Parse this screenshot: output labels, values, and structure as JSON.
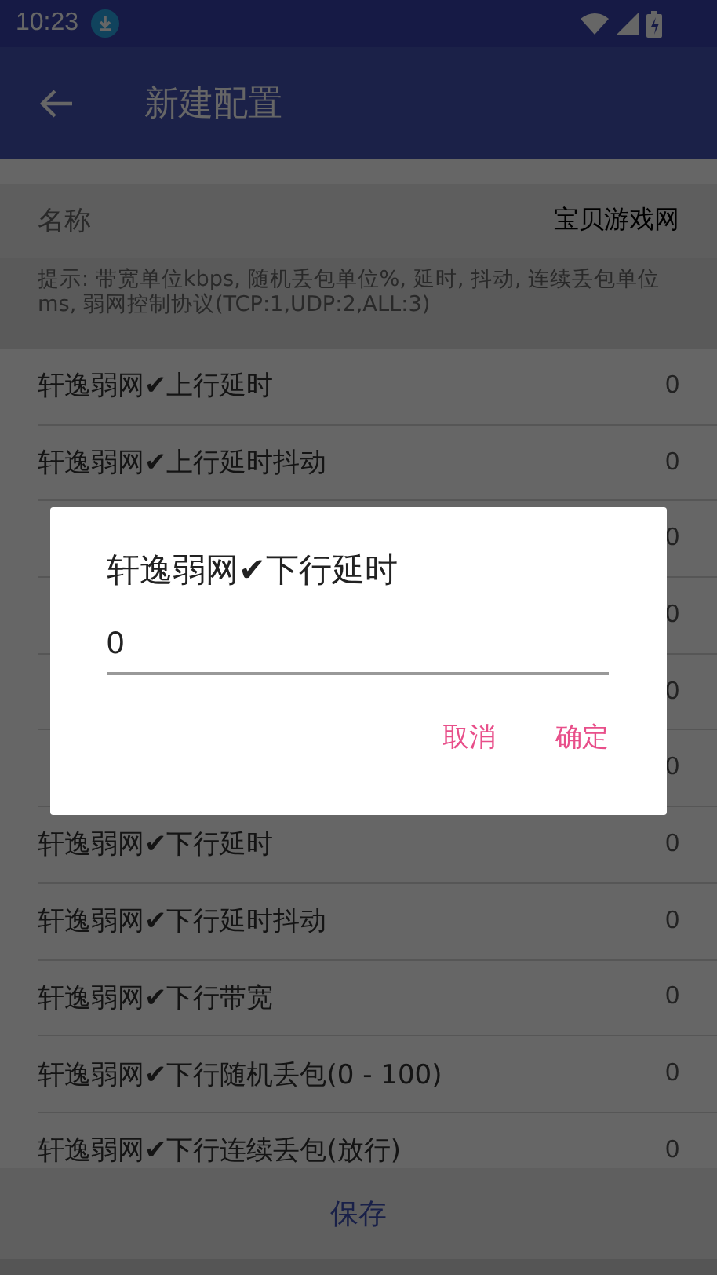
{
  "status_bar": {
    "time": "10:23"
  },
  "app_bar": {
    "title": "新建配置"
  },
  "name_field": {
    "label": "名称",
    "value": "宝贝游戏网"
  },
  "hint": "提示: 带宽单位kbps, 随机丢包单位%, 延时, 抖动, 连续丢包单位ms, 弱网控制协议(TCP:1,UDP:2,ALL:3)",
  "settings": [
    {
      "label": "轩逸弱网✔上行延时",
      "value": "0"
    },
    {
      "label": "轩逸弱网✔上行延时抖动",
      "value": "0"
    },
    {
      "value": "0"
    },
    {
      "value": "0"
    },
    {
      "value": "0"
    },
    {
      "value": "0"
    },
    {
      "label": "轩逸弱网✔下行延时",
      "value": "0"
    },
    {
      "label": "轩逸弱网✔下行延时抖动",
      "value": "0"
    },
    {
      "label": "轩逸弱网✔下行带宽",
      "value": "0"
    },
    {
      "label": "轩逸弱网✔下行随机丢包(0 - 100)",
      "value": "0"
    },
    {
      "label": "轩逸弱网✔下行连续丢包(放行)",
      "value": "0"
    }
  ],
  "dialog": {
    "title": "轩逸弱网✔下行延时",
    "input_value": "0",
    "buttons": [
      "取消",
      "确定"
    ]
  },
  "save_button": "保存"
}
